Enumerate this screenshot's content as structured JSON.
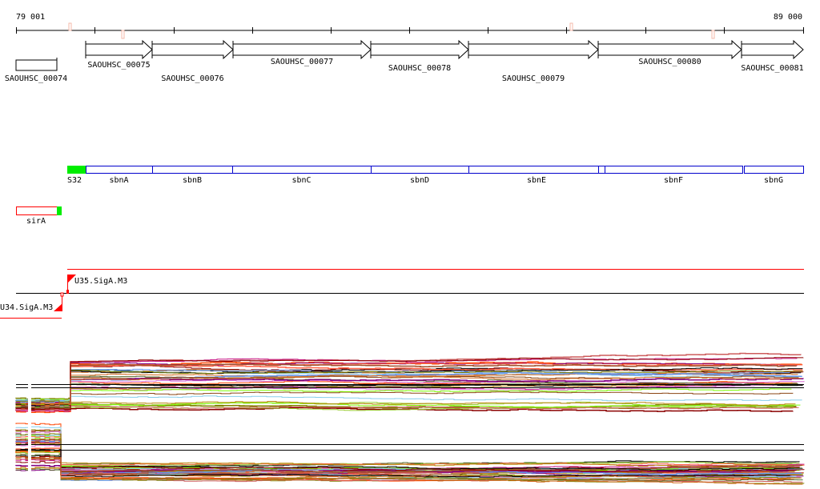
{
  "ruler": {
    "start_label": "79 001",
    "end_label": "89 000"
  },
  "genes": [
    {
      "id": "SAOUHSC_00074"
    },
    {
      "id": "SAOUHSC_00075"
    },
    {
      "id": "SAOUHSC_00076"
    },
    {
      "id": "SAOUHSC_00077"
    },
    {
      "id": "SAOUHSC_00078"
    },
    {
      "id": "SAOUHSC_00079"
    },
    {
      "id": "SAOUHSC_00080"
    },
    {
      "id": "SAOUHSC_00081"
    }
  ],
  "operon": {
    "leader": "S32",
    "genes": [
      "sbnA",
      "sbnB",
      "sbnC",
      "sbnD",
      "sbnE",
      "sbnF",
      "sbnG"
    ]
  },
  "sira": {
    "label": "sirA"
  },
  "promoters": [
    {
      "label": "U35.SigA.M3"
    },
    {
      "label": "U34.SigA.M3"
    }
  ],
  "colors": {
    "operon": "#0000cc",
    "leader": "#00ee00",
    "promoter": "#ff0000",
    "tick_mark": "#f4b8a8"
  }
}
